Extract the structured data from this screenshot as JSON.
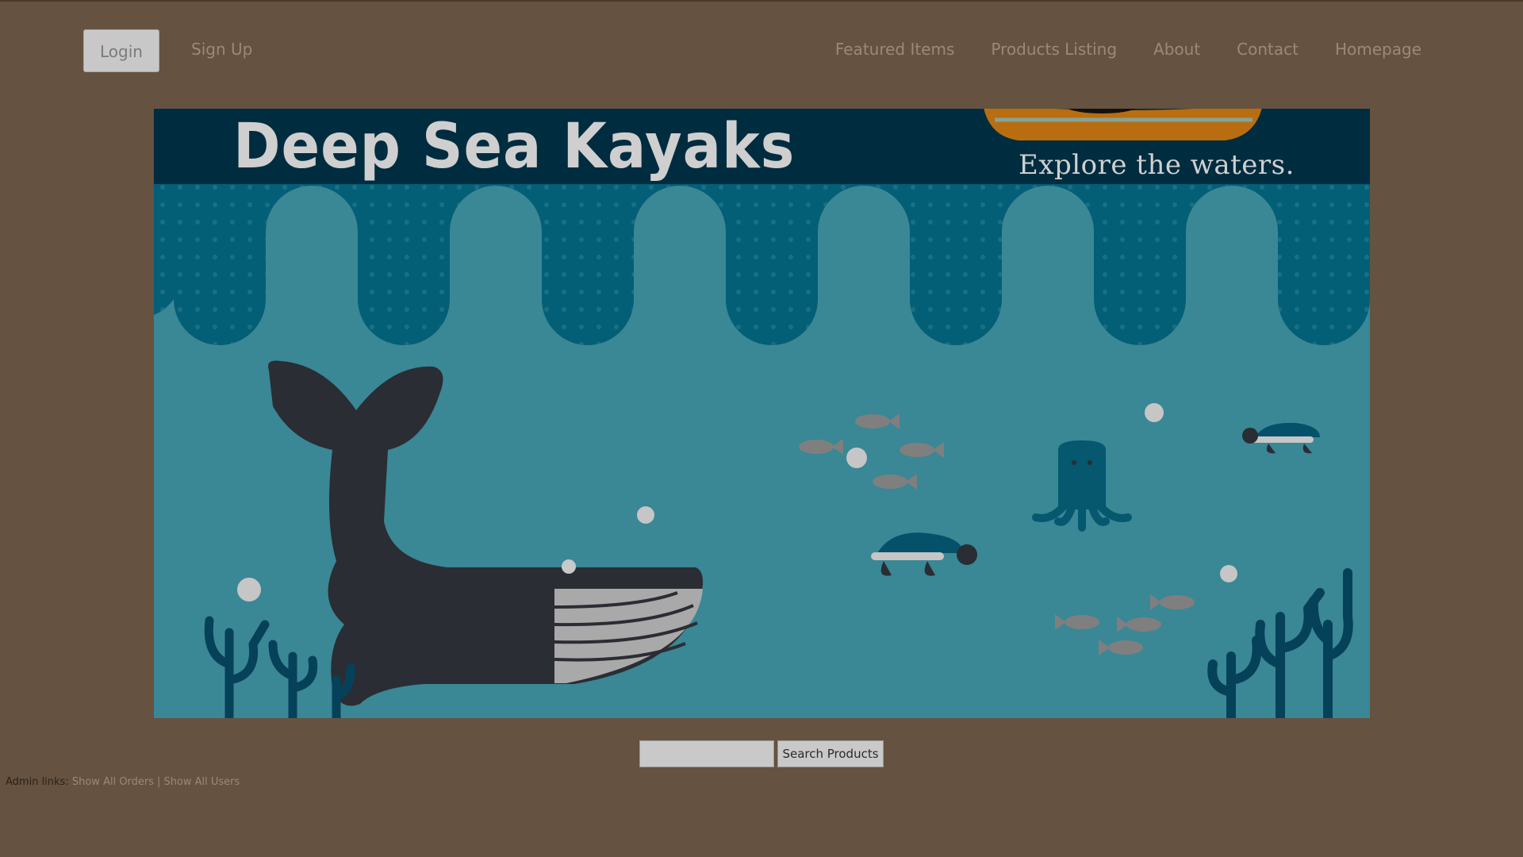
{
  "header": {
    "login_label": "Login",
    "signup_label": "Sign Up",
    "nav": [
      {
        "label": "Featured Items"
      },
      {
        "label": "Products Listing"
      },
      {
        "label": "About"
      },
      {
        "label": "Contact"
      },
      {
        "label": "Homepage"
      }
    ]
  },
  "banner": {
    "title": "Deep Sea Kayaks",
    "tagline": "Explore the waters."
  },
  "search": {
    "value": "",
    "placeholder": "",
    "button_label": "Search Products"
  },
  "admin": {
    "prefix": "Admin links:",
    "links": [
      {
        "label": "Show All Orders"
      },
      {
        "label": "Show All Users"
      }
    ],
    "separator": "|"
  },
  "colors": {
    "page_bg": "#665240",
    "banner_header": "#002c3f",
    "water": "#3a8796",
    "wave": "#035f75",
    "whale": "#2a2d33",
    "nav_text": "#998a76"
  },
  "icons": {
    "kayak": "kayak-icon",
    "whale": "whale-icon",
    "fish": "fish-icon",
    "turtle": "turtle-icon",
    "octopus": "octopus-icon",
    "coral": "coral-icon"
  }
}
